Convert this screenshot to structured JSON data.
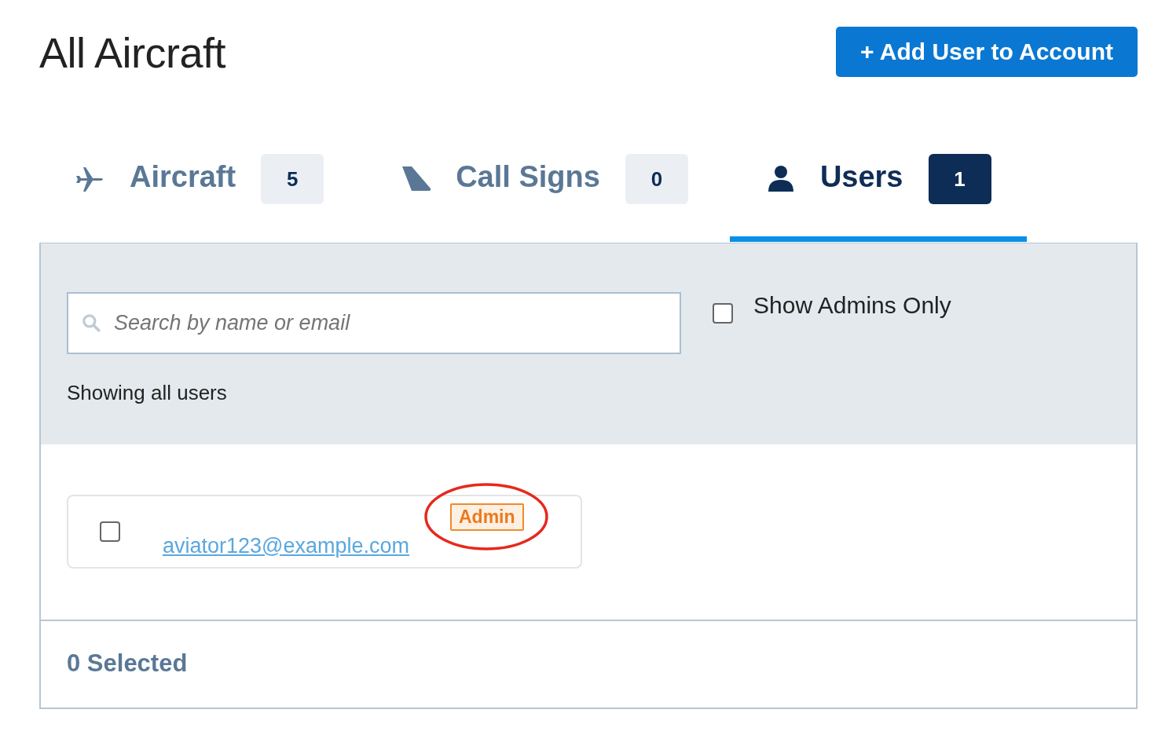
{
  "title": "All Aircraft",
  "add_button": {
    "icon": "+",
    "label": "Add User to Account"
  },
  "tabs": [
    {
      "kind": "plane",
      "label": "Aircraft",
      "count": "5",
      "selected": false
    },
    {
      "kind": "tail",
      "label": "Call Signs",
      "count": "0",
      "selected": false
    },
    {
      "kind": "person",
      "label": "Users",
      "count": "1",
      "selected": true
    }
  ],
  "search": {
    "placeholder": "Search by name or email"
  },
  "admins_only": {
    "label": "Show Admins Only",
    "checked": false
  },
  "filter_status": "Showing all users",
  "users": [
    {
      "email": "aviator123@example.com",
      "badge": "Admin",
      "checked": false,
      "highlighted": true
    }
  ],
  "footer": {
    "selected_count": "0 Selected"
  }
}
